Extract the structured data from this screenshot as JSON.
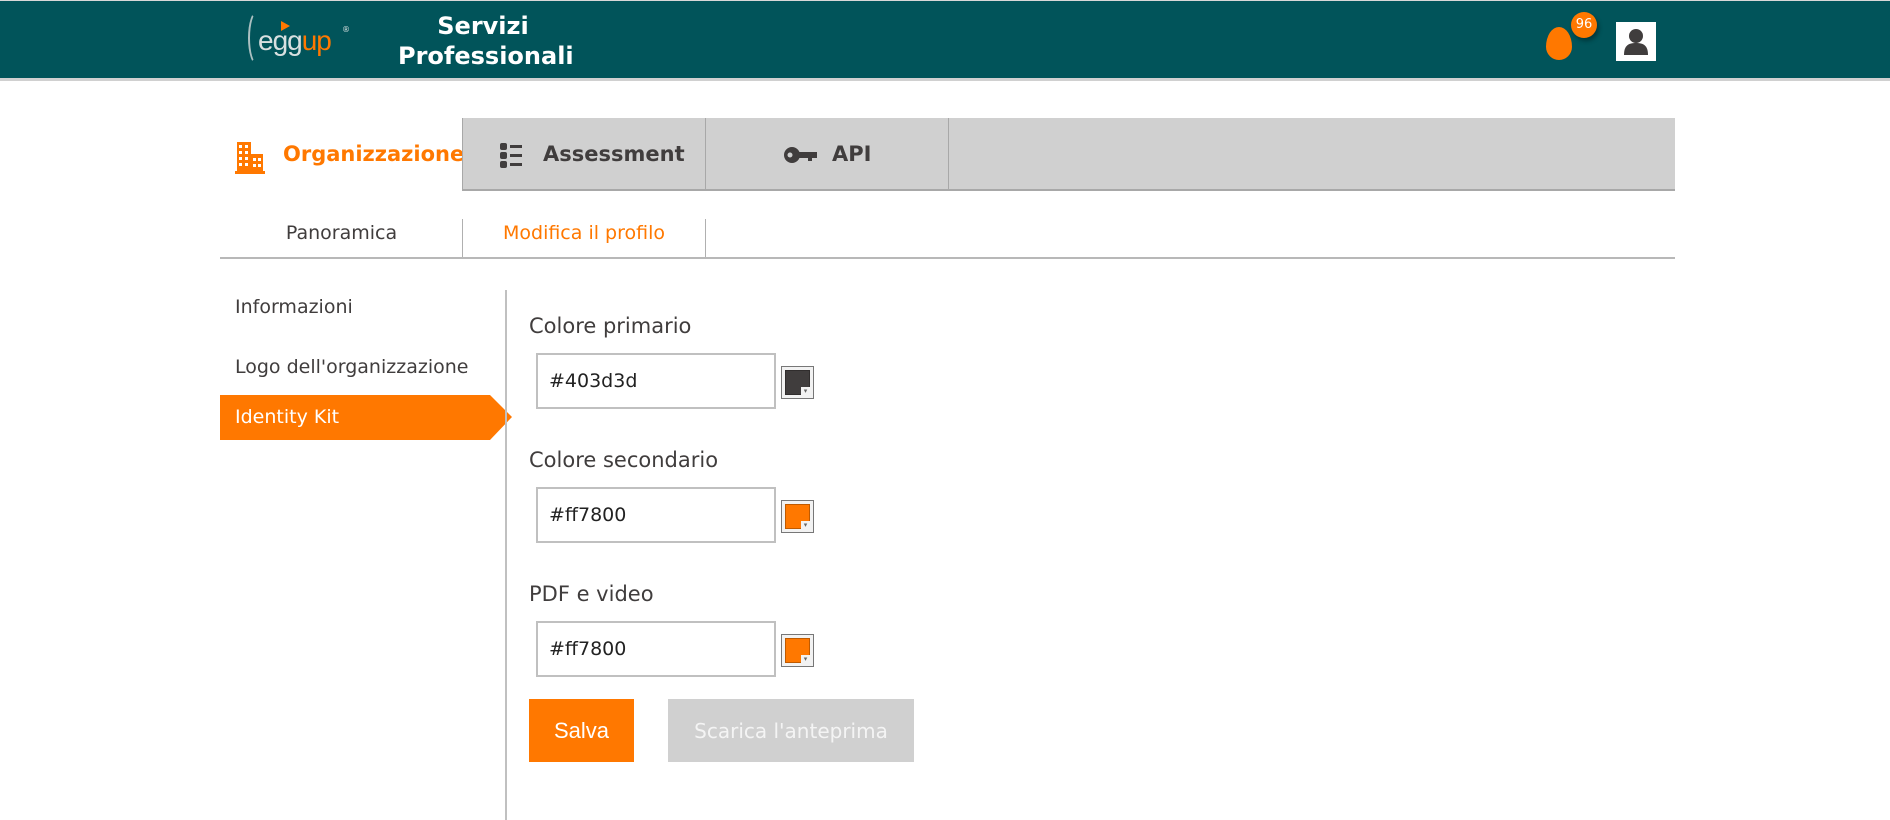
{
  "header": {
    "logo_text_main": "egg",
    "logo_text_accent": "up",
    "logo_reg": "®",
    "title_line1": "Servizi",
    "title_line2": "Professionali",
    "notification_count": "96",
    "notification_icon": "egg-icon",
    "user_icon": "user-avatar-icon"
  },
  "main_tabs": [
    {
      "label": "Organizzazione",
      "icon": "building-icon",
      "active": true
    },
    {
      "label": "Assessment",
      "icon": "list-icon",
      "active": false
    },
    {
      "label": "API",
      "icon": "key-icon",
      "active": false
    }
  ],
  "sub_tabs": [
    {
      "label": "Panoramica",
      "active": false
    },
    {
      "label": "Modifica il profilo",
      "active": true
    }
  ],
  "sidebar": {
    "items": [
      {
        "label": "Informazioni",
        "active": false
      },
      {
        "label": "Logo dell'organizzazione",
        "active": false
      },
      {
        "label": "Identity Kit",
        "active": true
      }
    ]
  },
  "form": {
    "fields": [
      {
        "label": "Colore primario",
        "value": "#403d3d",
        "swatch_color": "#403d3d"
      },
      {
        "label": "Colore secondario",
        "value": "#ff7800",
        "swatch_color": "#ff7800"
      },
      {
        "label": "PDF e video",
        "value": "#ff7800",
        "swatch_color": "#ff7800"
      }
    ],
    "save_label": "Salva",
    "preview_label": "Scarica l'anteprima"
  },
  "colors": {
    "header_bg": "#01545a",
    "accent": "#ff7800",
    "text": "#403d3d",
    "tab_gray": "#d0d0d0"
  }
}
